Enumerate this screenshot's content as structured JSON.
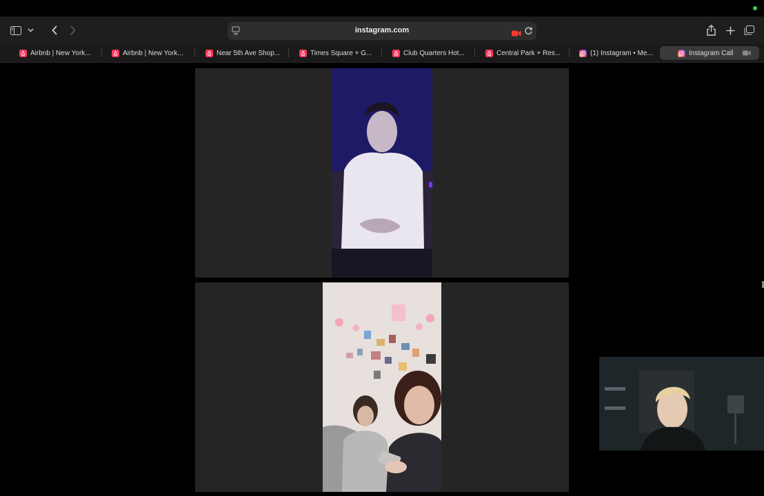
{
  "browser": {
    "url": "instagram.com",
    "tabs": [
      {
        "label": "Airbnb | New York...",
        "favicon": "airbnb-icon"
      },
      {
        "label": "Airbnb | New York...",
        "favicon": "airbnb-icon"
      },
      {
        "label": "Near 5th Ave Shop...",
        "favicon": "airbnb-icon"
      },
      {
        "label": "Times Square + G...",
        "favicon": "airbnb-icon"
      },
      {
        "label": "Club Quarters Hot...",
        "favicon": "airbnb-icon"
      },
      {
        "label": "Central Park + Res...",
        "favicon": "airbnb-icon"
      },
      {
        "label": "(1) Instagram • Me...",
        "favicon": "instagram-icon"
      },
      {
        "label": "Instagram Call",
        "favicon": "instagram-icon",
        "active": true
      }
    ]
  },
  "call": {
    "participants": [
      {
        "name": "participant-1",
        "video": "video-feed"
      },
      {
        "name": "participant-2",
        "video": "video-feed"
      }
    ],
    "self_view": "self-video"
  },
  "colors": {
    "airbnb": "#ff385c",
    "instagram": "#d6249f",
    "camera_active": "#ff3b30",
    "status_dot": "#32d74b"
  }
}
